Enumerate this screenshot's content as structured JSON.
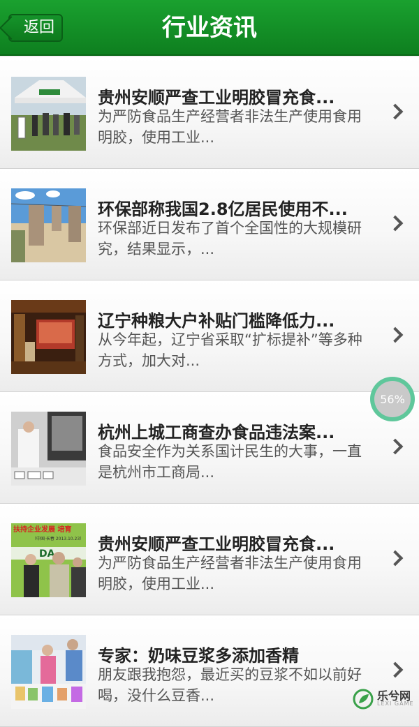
{
  "header": {
    "back_label": "返回",
    "title": "行业资讯"
  },
  "items": [
    {
      "title": "贵州安顺严查工业明胶冒充食...",
      "desc": "为严防食品生产经营者非法生产使用食用明胶，使用工业..."
    },
    {
      "title": "环保部称我国2.8亿居民使用不...",
      "desc": "环保部近日发布了首个全国性的大规模研究，结果显示，..."
    },
    {
      "title": "辽宁种粮大户补贴门槛降低力...",
      "desc": "从今年起，辽宁省采取“扩标提补”等多种方式，加大对..."
    },
    {
      "title": "杭州上城工商查办食品违法案...",
      "desc": "食品安全作为关系国计民生的大事，一直是杭州市工商局..."
    },
    {
      "title": "贵州安顺严查工业明胶冒充食...",
      "desc": "为严防食品生产经营者非法生产使用食用明胶，使用工业..."
    },
    {
      "title": "专家：奶味豆浆多添加香精",
      "desc": "朋友跟我抱怨，最近买的豆浆不如以前好喝，没什么豆香..."
    }
  ],
  "thumb_texts": {
    "photo5_banner": "扶持企业发展 培育",
    "photo5_date": "（中国·长春 2013.10.23）",
    "photo5_brand": "DA"
  },
  "progress": {
    "label": "56%"
  },
  "watermark": {
    "brand": "乐兮网",
    "sub": "LEXI GAME"
  },
  "colors": {
    "header": "#13912a",
    "accent": "#5fc79b"
  }
}
